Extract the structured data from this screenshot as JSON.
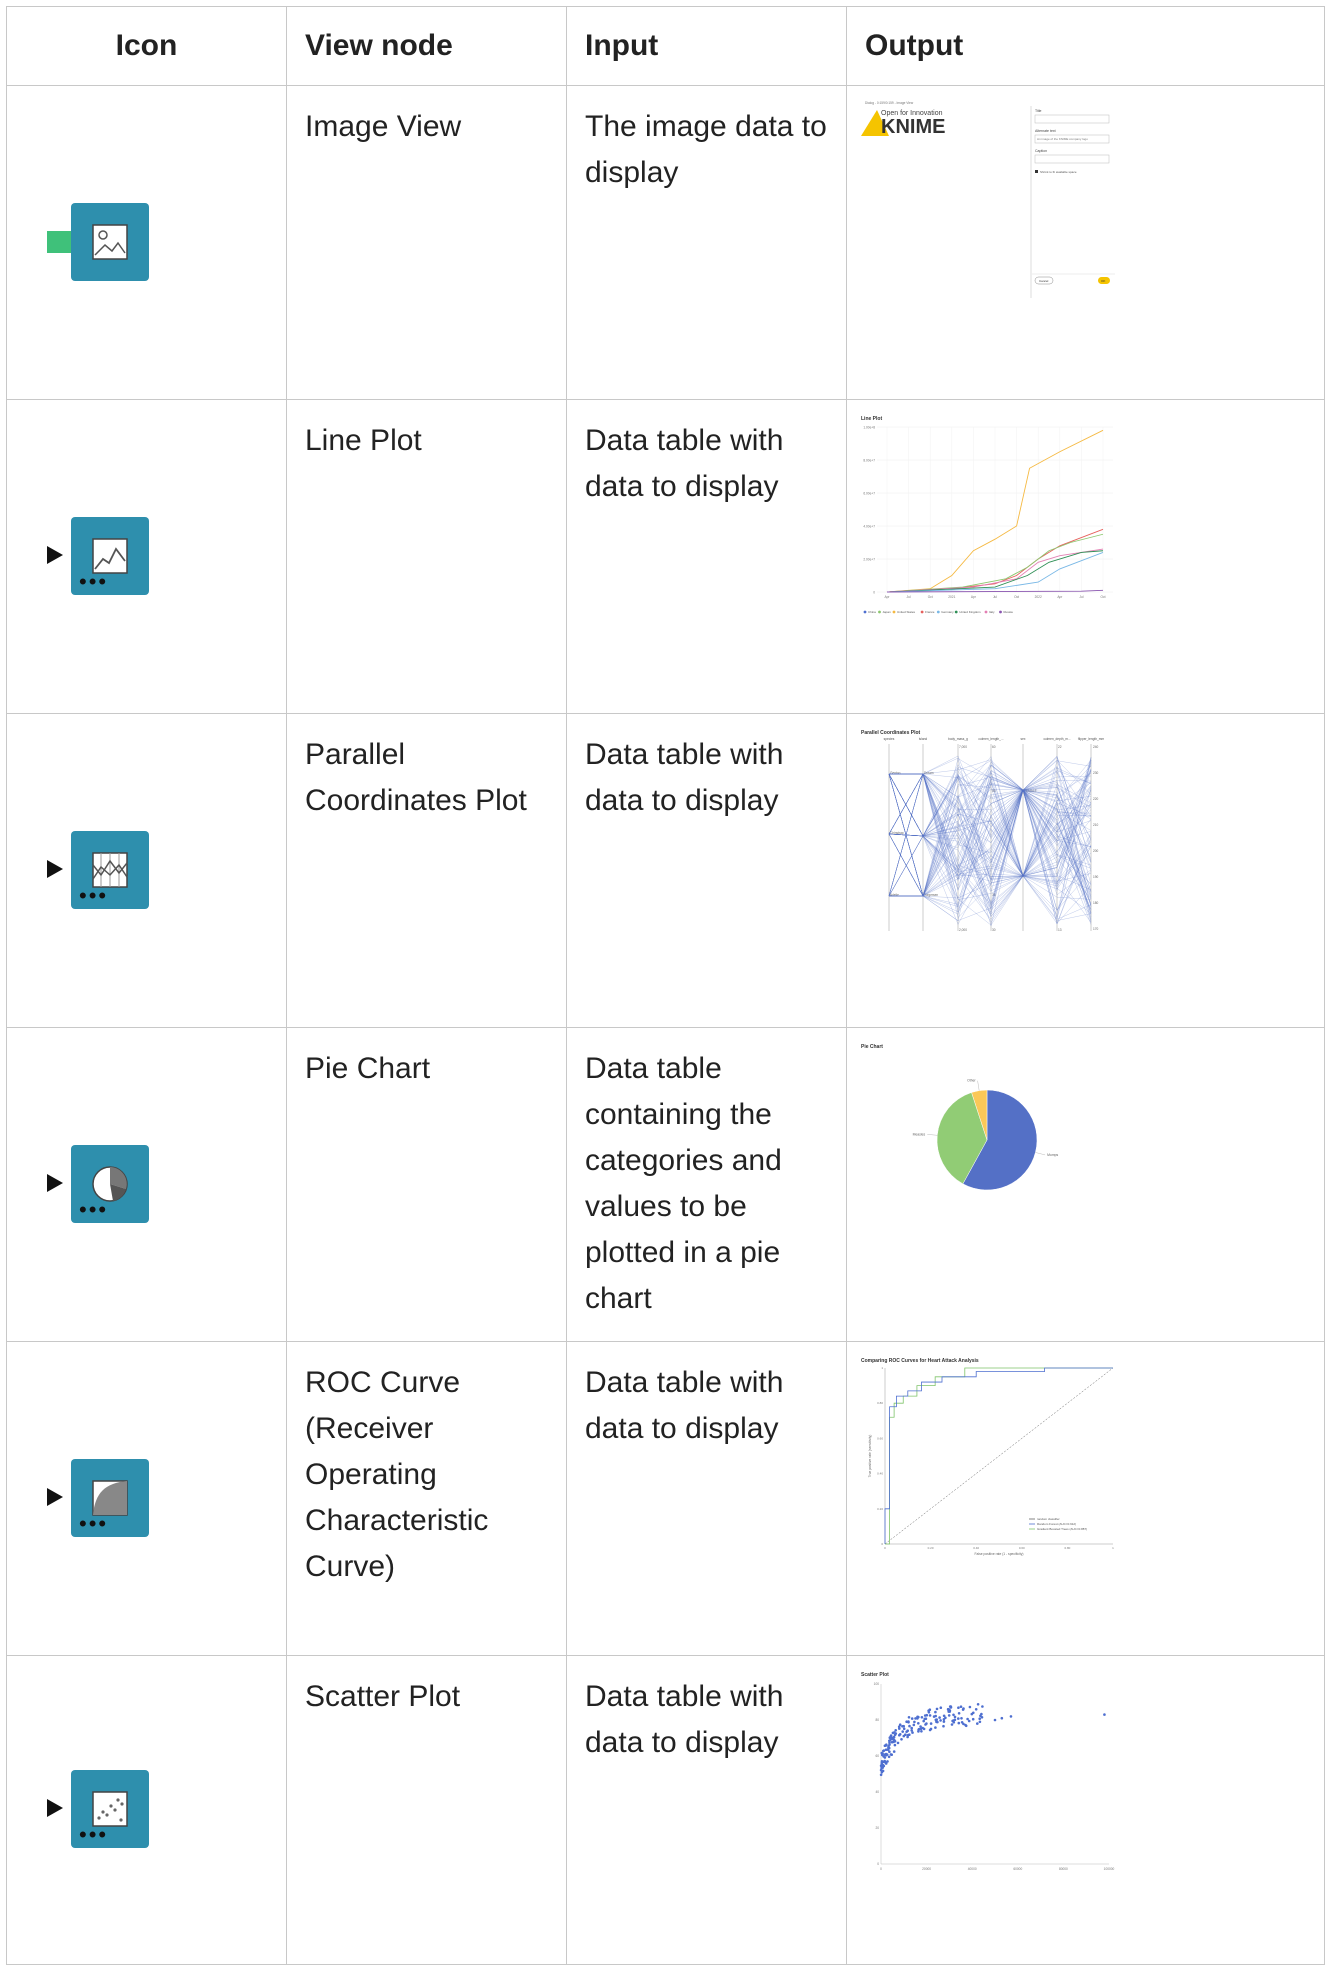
{
  "table": {
    "headers": {
      "icon": "Icon",
      "view_node": "View node",
      "input": "Input",
      "output": "Output"
    },
    "rows": [
      {
        "node": "Image View",
        "input": "The image data to display",
        "icon": "image-view-icon",
        "port": "image",
        "output": {
          "window_title": "Dialog - 0:159/0:159 - Image View",
          "tagline": "Open for Innovation",
          "logo": "KNIME",
          "title_label": "Title",
          "alt_label": "Alternate text",
          "alt_value": "An image of the KNIME company logo",
          "caption_label": "Caption",
          "checkbox_label": "Shrink to fit available space",
          "cancel": "Cancel",
          "ok": "OK"
        }
      },
      {
        "node": "Line Plot",
        "input": "Data table with data to display",
        "icon": "line-plot-icon",
        "port": "table",
        "output": {
          "title": "Line Plot",
          "y_ticks": [
            "1.00e+8",
            "8.00e+7",
            "6.00e+7",
            "4.00e+7",
            "2.00e+7",
            "0"
          ],
          "x_ticks": [
            "Apr",
            "Jul",
            "Oct",
            "2021",
            "Apr",
            "Jul",
            "Oct",
            "2022",
            "Apr",
            "Jul",
            "Oct"
          ],
          "legend": [
            "China",
            "Japan",
            "United States",
            "France",
            "Germany",
            "United Kingdom",
            "Italy",
            "Russia"
          ],
          "colors": [
            "#4e6fd0",
            "#8cc76e",
            "#f5b942",
            "#e6615d",
            "#79b8e6",
            "#2e8f55",
            "#e37fb3",
            "#8a55b0"
          ]
        }
      },
      {
        "node": "Parallel Coordinates Plot",
        "input": "Data table with data to display",
        "icon": "parallel-coordinates-icon",
        "port": "table",
        "output": {
          "title": "Parallel Coordinates Plot",
          "axes": [
            "species",
            "island",
            "body_mass_g",
            "culmen_length_...",
            "sex",
            "culmen_depth_m...",
            "flipper_length_mm"
          ],
          "species": [
            "Gentoo",
            "Chinstrap",
            "Adelie"
          ],
          "islands": [
            "Dream",
            "Torgersen"
          ],
          "sexes": [
            "FEMALE"
          ],
          "mass_ticks": [
            "7,000",
            "2,000"
          ],
          "length_ticks": [
            "60",
            "55",
            "35",
            "30"
          ],
          "depth_ticks": [
            "22",
            "13"
          ],
          "flipper_ticks": [
            "240",
            "230",
            "220",
            "210",
            "200",
            "190",
            "180",
            "170"
          ]
        }
      },
      {
        "node": "Pie Chart",
        "input": "Data table containing the categories and values to be plotted in a pie chart",
        "icon": "pie-chart-icon",
        "port": "table",
        "output": {
          "title": "Pie Chart",
          "chart_data": {
            "type": "pie",
            "labels": [
              "Mumps",
              "Measles",
              "Other"
            ],
            "values": [
              58,
              37,
              5
            ],
            "colors": [
              "#5470c6",
              "#91cc75",
              "#fac858"
            ]
          }
        }
      },
      {
        "node": "ROC Curve (Receiver Operating Characteristic Curve)",
        "input": "Data table with data to display",
        "icon": "roc-curve-icon",
        "port": "table",
        "output": {
          "title": "Comparing ROC Curves for Heart Attack Analysis",
          "xlabel": "False positive rate (1 - specificity)",
          "ylabel": "True positive rate (sensitivity)",
          "ticks": [
            "0",
            "0.20",
            "0.40",
            "0.60",
            "0.80",
            "1"
          ],
          "legend": [
            "random classifier",
            "Random Forest (AUC=0.912)",
            "Gradient Boosted Trees (AUC=0.887)"
          ]
        }
      },
      {
        "node": "Scatter Plot",
        "input": "Data table with data to display",
        "icon": "scatter-plot-icon",
        "port": "table",
        "output": {
          "title": "Scatter Plot",
          "y_ticks": [
            "100",
            "80",
            "60",
            "40",
            "20",
            "0"
          ],
          "x_ticks": [
            "0",
            "20000",
            "40000",
            "60000",
            "80000",
            "100000"
          ]
        }
      }
    ]
  }
}
